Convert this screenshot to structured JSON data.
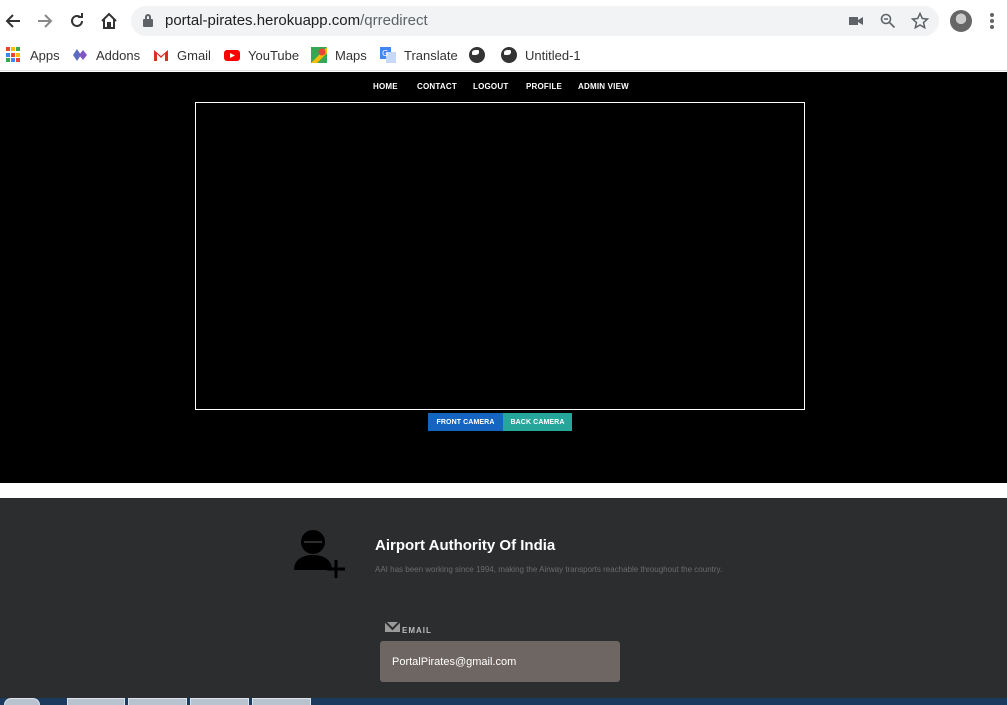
{
  "browser": {
    "url_host": "portal-pirates.herokuapp.com",
    "url_path": "/qrredirect",
    "nav": {
      "back_icon": "arrow-left-icon",
      "forward_icon": "arrow-right-icon",
      "reload_icon": "reload-icon",
      "home_icon": "home-icon"
    },
    "omnibox_icons": [
      "camera-icon",
      "zoom-icon",
      "star-icon"
    ]
  },
  "bookmarks": [
    {
      "label": "Apps",
      "icon": "apps-grid-icon"
    },
    {
      "label": "Addons",
      "icon": "addons-icon"
    },
    {
      "label": "Gmail",
      "icon": "gmail-icon"
    },
    {
      "label": "YouTube",
      "icon": "youtube-icon"
    },
    {
      "label": "Maps",
      "icon": "maps-icon"
    },
    {
      "label": "Translate",
      "icon": "translate-icon"
    },
    {
      "label": "",
      "icon": "globe-icon"
    },
    {
      "label": "Untitled-1",
      "icon": "globe-icon"
    }
  ],
  "site_nav": [
    "HOME",
    "CONTACT",
    "LOGOUT",
    "PROFILE",
    "ADMIN VIEW"
  ],
  "camera": {
    "front_label": "FRONT CAMERA",
    "back_label": "BACK CAMERA",
    "front_color": "#1565c0",
    "back_color": "#26a69a"
  },
  "footer": {
    "title": "Airport Authority Of India",
    "description": "AAI has been working since 1994, making the Airway transports reachable throughout the country.",
    "email_label": "EMAIL",
    "email_value": "PortalPirates@gmail.com"
  },
  "colors": {
    "page_background": "#000000",
    "footer_background": "#2b2d2f",
    "email_box": "#6e6663"
  }
}
